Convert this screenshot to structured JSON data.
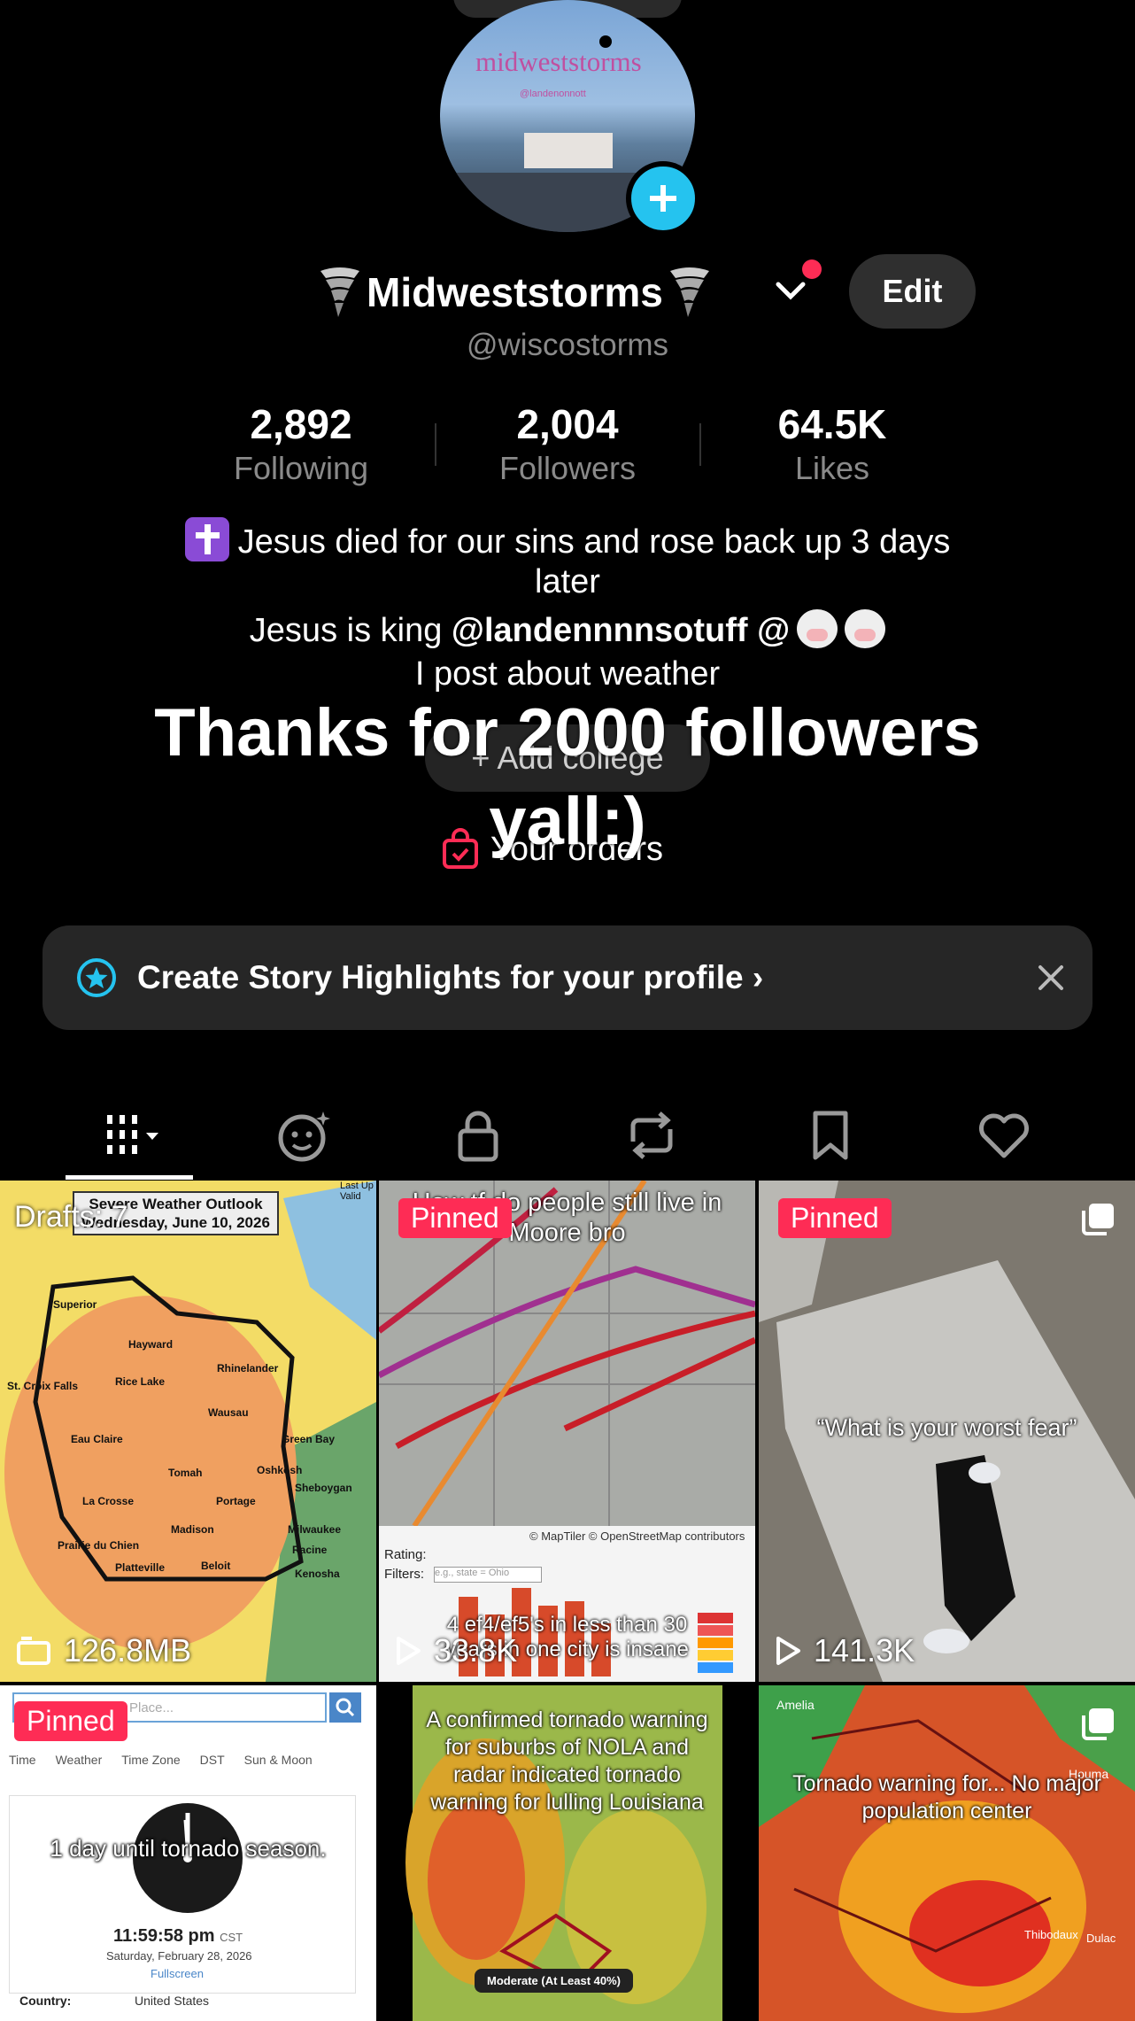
{
  "profile": {
    "display_name": "Midweststorms",
    "handle": "@wiscostorms",
    "edit_label": "Edit",
    "avatar_text": "midweststorms",
    "avatar_subtext": "@landenonnott"
  },
  "stats": [
    {
      "value": "2,892",
      "label": "Following"
    },
    {
      "value": "2,004",
      "label": "Followers"
    },
    {
      "value": "64.5K",
      "label": "Likes"
    }
  ],
  "bio": {
    "line1": "Jesus died for our sins and rose back up 3 days",
    "line2": "later",
    "line3_prefix": "Jesus is king ",
    "line3_mention": "@landennnnsotuff @",
    "line4": "I post about weather"
  },
  "college_label": "+ Add college",
  "orders_label": "Your orders",
  "overlay_text": "Thanks for 2000 followers yall:)",
  "highlight_banner": {
    "text": "Create Story Highlights for your profile"
  },
  "tabs": [
    {
      "icon": "videos-grid-icon",
      "active": true
    },
    {
      "icon": "ai-face-icon"
    },
    {
      "icon": "lock-icon"
    },
    {
      "icon": "repost-icon"
    },
    {
      "icon": "bookmark-icon"
    },
    {
      "icon": "heart-icon"
    }
  ],
  "grid": [
    {
      "top_label": "Drafts: 7",
      "map_title": "Severe Weather Outlook",
      "map_date": "Wednesday, June 10, 2026",
      "map_corner": "Last Up\nValid",
      "bottom": "126.8MB",
      "cities": [
        "Superior",
        "Hayward",
        "Rhinelander",
        "St. Croix Falls",
        "Rice Lake",
        "Wausau",
        "Eau Claire",
        "Green Bay",
        "Tomah",
        "Oshkosh",
        "Sheboygan",
        "La Crosse",
        "Portage",
        "Madison",
        "Milwaukee",
        "Prairie du Chien",
        "Racine",
        "Platteville",
        "Beloit",
        "Kenosha"
      ]
    },
    {
      "badge": "Pinned",
      "caption_top": "How tf do people still live in Moore bro",
      "map_credit": "© MapTiler © OpenStreetMap contributors",
      "rating_label": "Rating:",
      "filters_label": "Filters:",
      "filters_placeholder": "e.g., state = Ohio",
      "caption_bottom": "4 ef4/ef5's in less than 30 years in one city is insane",
      "views": "33.8K"
    },
    {
      "badge": "Pinned",
      "caption": "“What is your worst fear”",
      "views": "141.3K"
    },
    {
      "badge": "Pinned",
      "search_placeholder": "Place...",
      "tabs": [
        "Time",
        "Weather",
        "Time Zone",
        "DST",
        "Sun & Moon"
      ],
      "caption": "1 day until tornado season.",
      "time": "11:59:58 pm",
      "tz": "CST",
      "date": "Saturday, February 28, 2026",
      "fullscreen": "Fullscreen",
      "country_label": "Country:",
      "country_value": "United States"
    },
    {
      "caption": "A confirmed tornado warning for suburbs of NOLA and radar indicated tornado warning for lulling Louisiana",
      "risk_label": "Moderate (At Least 40%)"
    },
    {
      "caption": "Tornado warning for... No major population center",
      "places": [
        "Amelia",
        "Houma",
        "Thibodaux",
        "Dulac"
      ]
    }
  ],
  "colors": {
    "accent": "#fe2c55",
    "plus": "#25c3ef",
    "highlight_bg": "#262626"
  }
}
